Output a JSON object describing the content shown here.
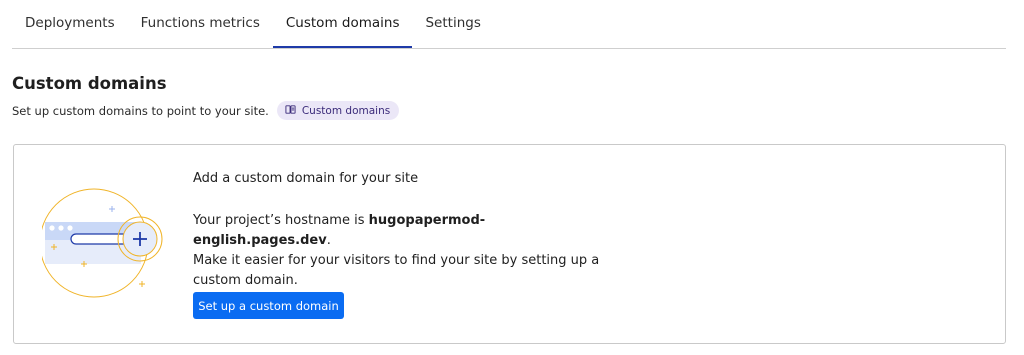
{
  "tabs": [
    {
      "label": "Deployments",
      "active": false
    },
    {
      "label": "Functions metrics",
      "active": false
    },
    {
      "label": "Custom domains",
      "active": true
    },
    {
      "label": "Settings",
      "active": false
    }
  ],
  "section": {
    "title": "Custom domains",
    "subtitle": "Set up custom domains to point to your site.",
    "doc_link": {
      "label": "Custom domains",
      "icon": "book-icon"
    }
  },
  "card": {
    "illustration": "browser-add-domain-illustration",
    "title": "Add a custom domain for your site",
    "hostname_prefix": "Your project’s hostname is",
    "hostname": "hugopapermod-english.pages.dev",
    "hostname_suffix": ".",
    "description": "Make it easier for your visitors to find your site by setting up a custom domain.",
    "cta_label": "Set up a custom domain"
  },
  "colors": {
    "active_tab": "#1e3aa8",
    "primary_button": "#0a6cf2",
    "pill_bg": "#ebe7f7",
    "accent_orange": "#f0b429"
  }
}
